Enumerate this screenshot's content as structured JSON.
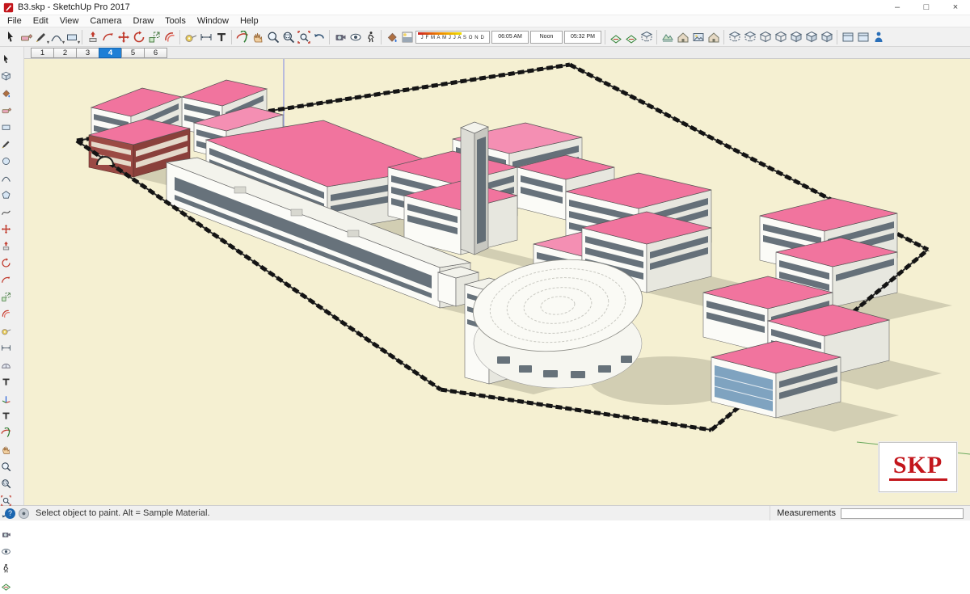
{
  "window": {
    "title": "B3.skp - SketchUp Pro 2017",
    "minimize": "–",
    "maximize": "□",
    "close": "×"
  },
  "menu": {
    "items": [
      "File",
      "Edit",
      "View",
      "Camera",
      "Draw",
      "Tools",
      "Window",
      "Help"
    ]
  },
  "scene_tabs": [
    {
      "label": "1"
    },
    {
      "label": "2"
    },
    {
      "label": "3"
    },
    {
      "label": "4",
      "selected": true
    },
    {
      "label": "5"
    },
    {
      "label": "6"
    }
  ],
  "shadows": {
    "months": "J F M A M J J A S O N D",
    "start_time": "06:05 AM",
    "noon_label": "Noon",
    "end_time": "05:32 PM"
  },
  "status": {
    "help_glyph": "?",
    "hint": "Select object to paint. Alt = Sample Material.",
    "measurements_label": "Measurements",
    "measurements_value": ""
  },
  "viewport": {
    "logo_text": "SKP"
  },
  "colors": {
    "roof_pink": "#F1749E",
    "tab_selected_blue": "#1E7FD6",
    "logo_red": "#C3161C",
    "ground_cream": "#F5F0D2"
  }
}
